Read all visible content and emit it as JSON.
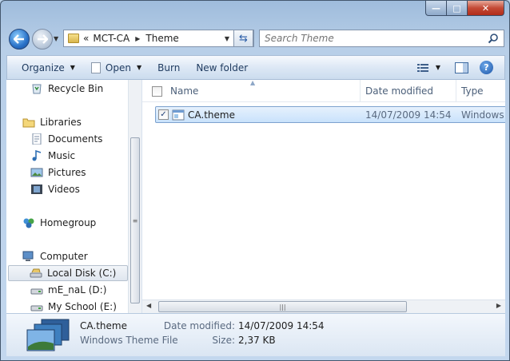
{
  "window": {
    "minimize": "—",
    "maximize": "□",
    "close": "✕"
  },
  "address": {
    "overflow": "«",
    "segments": [
      "MCT-CA",
      "Theme"
    ]
  },
  "search": {
    "placeholder": "Search Theme"
  },
  "toolbar": {
    "organize": "Organize",
    "open": "Open",
    "burn": "Burn",
    "new_folder": "New folder"
  },
  "navpane": {
    "items": [
      {
        "label": "Recycle Bin",
        "icon": "recycle-bin-icon"
      },
      {
        "label": "Libraries",
        "icon": "libraries-icon"
      },
      {
        "label": "Documents",
        "icon": "documents-icon"
      },
      {
        "label": "Music",
        "icon": "music-icon"
      },
      {
        "label": "Pictures",
        "icon": "pictures-icon"
      },
      {
        "label": "Videos",
        "icon": "videos-icon"
      },
      {
        "label": "Homegroup",
        "icon": "homegroup-icon"
      },
      {
        "label": "Computer",
        "icon": "computer-icon"
      },
      {
        "label": "Local Disk (C:)",
        "icon": "drive-icon"
      },
      {
        "label": "mE_naL (D:)",
        "icon": "drive-icon"
      },
      {
        "label": "My School (E:)",
        "icon": "drive-icon"
      }
    ]
  },
  "columns": {
    "name": "Name",
    "date_modified": "Date modified",
    "type": "Type"
  },
  "files": [
    {
      "name": "CA.theme",
      "date_modified": "14/07/2009 14:54",
      "type": "Windows T",
      "checked": true
    }
  ],
  "details": {
    "name": "CA.theme",
    "type": "Windows Theme File",
    "date_label": "Date modified:",
    "date_value": "14/07/2009 14:54",
    "size_label": "Size:",
    "size_value": "2,37 KB"
  },
  "colors": {
    "selection": "#cce4fb",
    "selection_border": "#7da2ce",
    "link_text": "#1e3a5f"
  }
}
